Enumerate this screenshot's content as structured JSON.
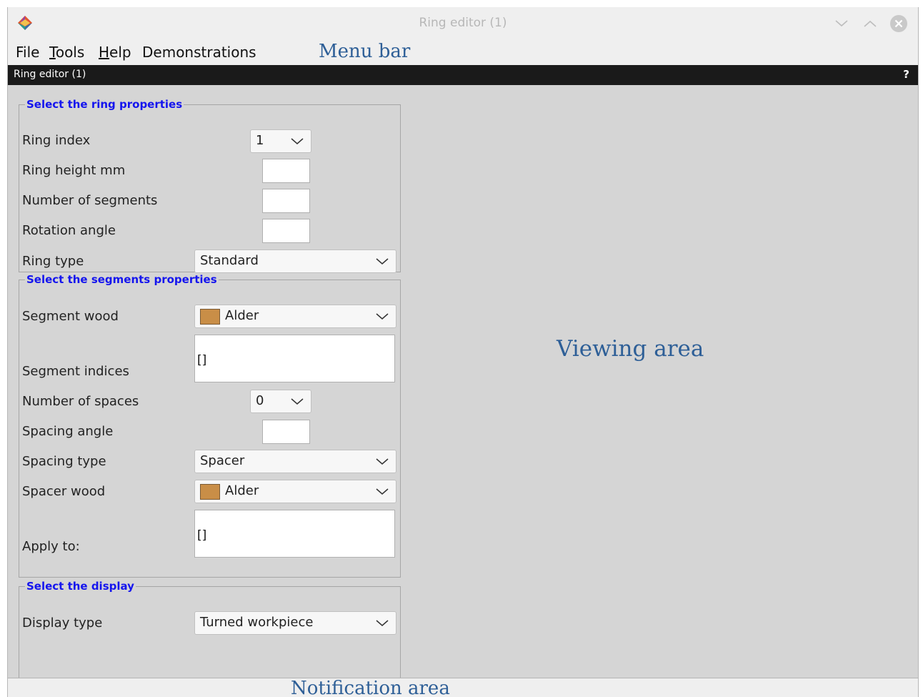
{
  "window": {
    "title": "Ring editor (1)"
  },
  "menu": {
    "items": [
      "File",
      "Tools",
      "Help",
      "Demonstrations"
    ],
    "mnemonics": {
      "tools_first": "T",
      "tools_rest": "ools",
      "help_first": "H",
      "help_rest": "elp"
    },
    "annotation": "Menu bar"
  },
  "dock": {
    "title": "Ring editor (1)",
    "help_symbol": "?"
  },
  "ring_group": {
    "legend": "Select the ring properties",
    "ring_index_label": "Ring index",
    "ring_index_value": "1",
    "ring_height_label": "Ring height mm",
    "ring_height_value": "",
    "num_segments_label": "Number of segments",
    "num_segments_value": "",
    "rotation_angle_label": "Rotation angle",
    "rotation_angle_value": "",
    "ring_type_label": "Ring type",
    "ring_type_value": "Standard"
  },
  "segments_group": {
    "legend": "Select the segments properties",
    "segment_wood_label": "Segment wood",
    "segment_wood_value": "Alder",
    "segment_indices_label": "Segment indices",
    "segment_indices_value": "[]",
    "num_spaces_label": "Number of spaces",
    "num_spaces_value": "0",
    "spacing_angle_label": "Spacing angle",
    "spacing_angle_value": "",
    "spacing_type_label": "Spacing type",
    "spacing_type_value": "Spacer",
    "spacer_wood_label": "Spacer wood",
    "spacer_wood_value": "Alder",
    "apply_to_label": "Apply to:",
    "apply_to_value": "[]"
  },
  "display_group": {
    "legend": "Select the display",
    "display_type_label": "Display type",
    "display_type_value": "Turned workpiece"
  },
  "annotations": {
    "viewing_area": "Viewing area",
    "notification_area": "Notification area"
  },
  "colors": {
    "wood_alder": "#c98e47",
    "legend_blue": "#1515ee",
    "annotation_blue": "#2e5f97",
    "dock_bar": "#1a1a1a"
  }
}
